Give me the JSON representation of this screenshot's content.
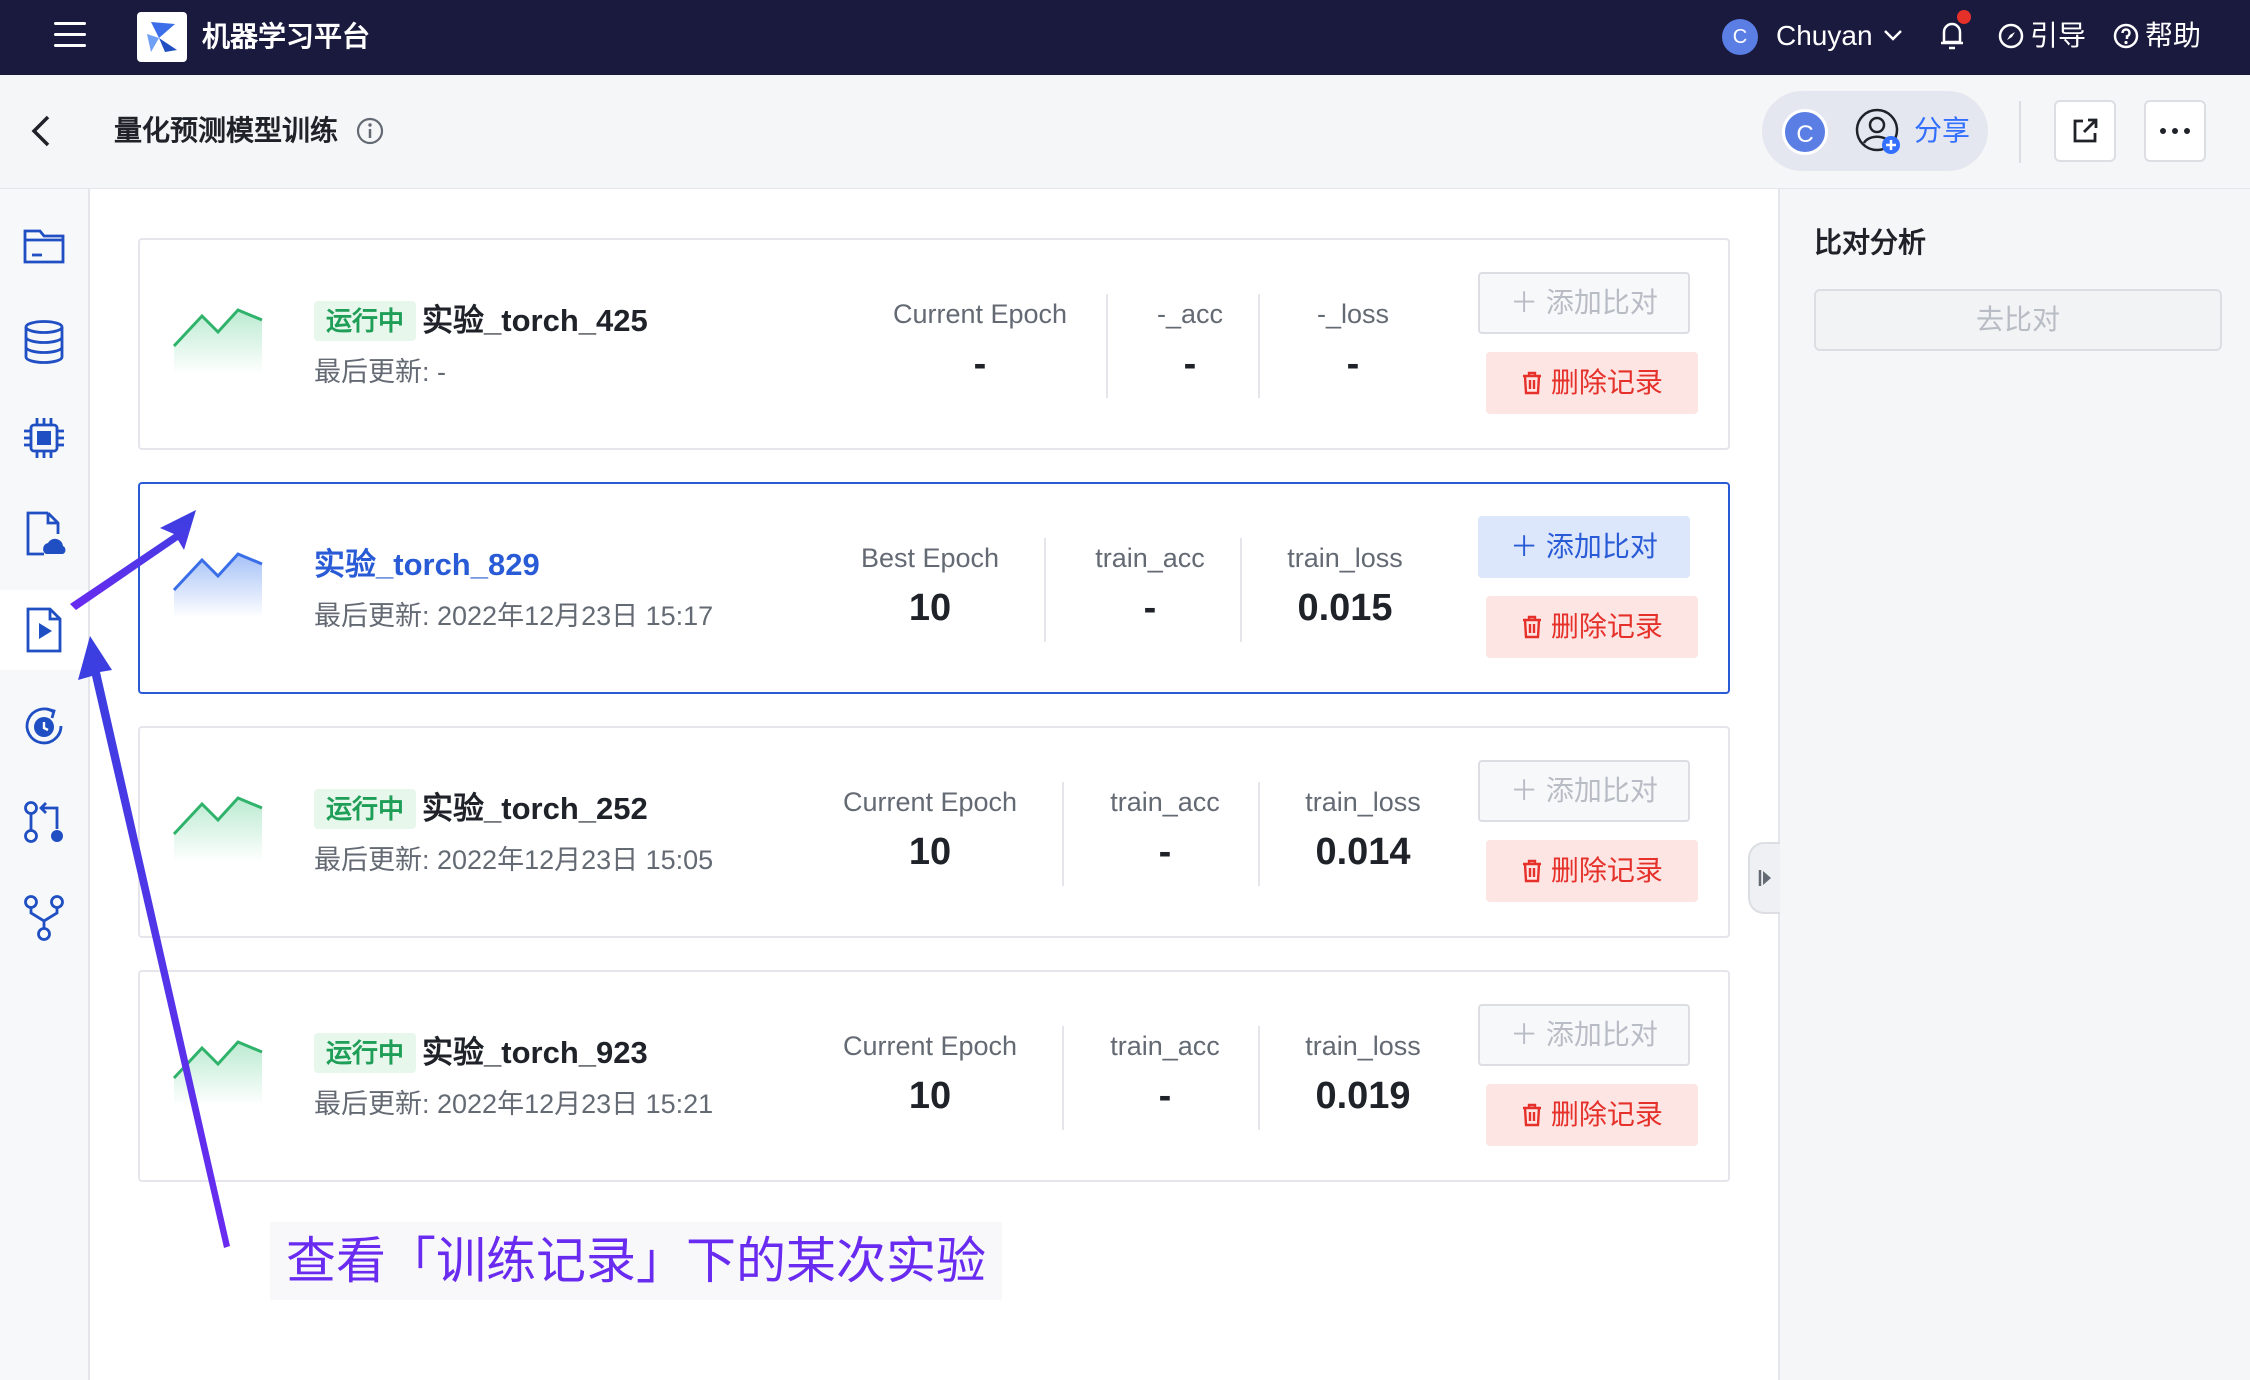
{
  "topbar": {
    "app_title": "机器学习平台",
    "user_initial": "C",
    "user_name": "Chuyan",
    "guide_label": "引导",
    "help_label": "帮助"
  },
  "subheader": {
    "title": "量化预测模型训练",
    "collaborator_initial": "C",
    "share_label": "分享"
  },
  "sidebar": {
    "items": [
      "folder-icon",
      "database-icon",
      "chip-icon",
      "cloud-file-icon",
      "play-file-icon",
      "clock-refresh-icon",
      "pipeline-icon",
      "branch-icon"
    ],
    "active_index": 4
  },
  "right_panel": {
    "title": "比对分析",
    "compare_button": "去比对"
  },
  "experiments": [
    {
      "status": "运行中",
      "name": "实验_torch_425",
      "updated": "最后更新: -",
      "metrics": [
        {
          "label": "Current Epoch",
          "value": "-"
        },
        {
          "label": "-_acc",
          "value": "-"
        },
        {
          "label": "-_loss",
          "value": "-"
        }
      ],
      "add_label": "添加比对",
      "delete_label": "删除记录"
    },
    {
      "status": "",
      "name": "实验_torch_829",
      "updated": "最后更新: 2022年12月23日 15:17",
      "metrics": [
        {
          "label": "Best Epoch",
          "value": "10"
        },
        {
          "label": "train_acc",
          "value": "-"
        },
        {
          "label": "train_loss",
          "value": "0.015"
        }
      ],
      "add_label": "添加比对",
      "delete_label": "删除记录"
    },
    {
      "status": "运行中",
      "name": "实验_torch_252",
      "updated": "最后更新: 2022年12月23日 15:05",
      "metrics": [
        {
          "label": "Current Epoch",
          "value": "10"
        },
        {
          "label": "train_acc",
          "value": "-"
        },
        {
          "label": "train_loss",
          "value": "0.014"
        }
      ],
      "add_label": "添加比对",
      "delete_label": "删除记录"
    },
    {
      "status": "运行中",
      "name": "实验_torch_923",
      "updated": "最后更新: 2022年12月23日 15:21",
      "metrics": [
        {
          "label": "Current Epoch",
          "value": "10"
        },
        {
          "label": "train_acc",
          "value": "-"
        },
        {
          "label": "train_loss",
          "value": "0.019"
        }
      ],
      "add_label": "添加比对",
      "delete_label": "删除记录"
    }
  ],
  "annotation": {
    "text": "查看「训练记录」下的某次实验"
  },
  "colors": {
    "topbar_bg": "#1a1a3e",
    "accent_blue": "#2a5bd7",
    "running_green": "#1e9e57",
    "delete_red": "#e5312a",
    "annotation_purple": "#6a2bf0"
  }
}
